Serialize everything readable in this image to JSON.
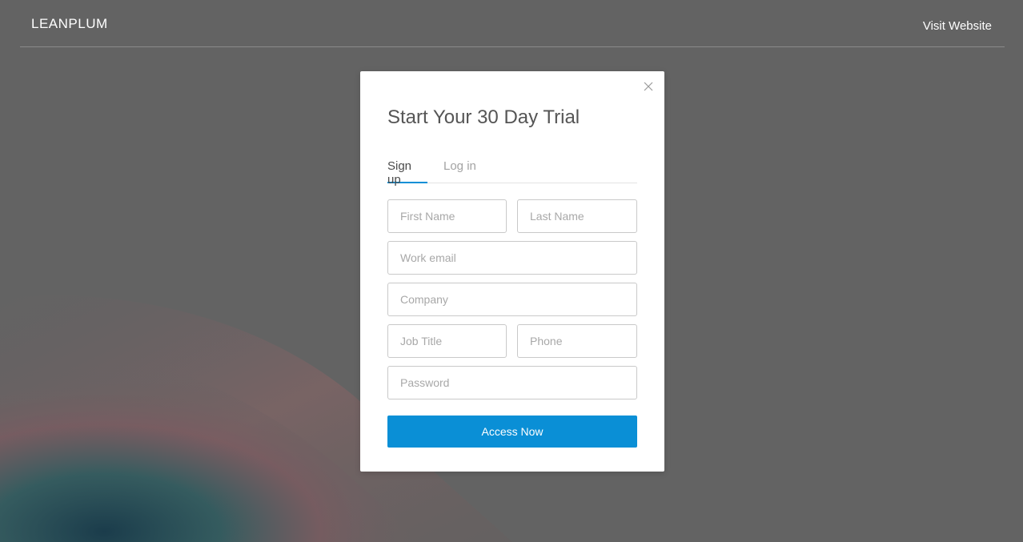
{
  "header": {
    "logo_text": "LEANPLUM",
    "visit_label": "Visit Website"
  },
  "modal": {
    "title": "Start Your 30 Day Trial",
    "close_icon": "close-icon",
    "tabs": [
      {
        "label": "Sign up",
        "active": true
      },
      {
        "label": "Log in",
        "active": false
      }
    ],
    "fields": {
      "first_name": {
        "placeholder": "First Name",
        "value": ""
      },
      "last_name": {
        "placeholder": "Last Name",
        "value": ""
      },
      "work_email": {
        "placeholder": "Work email",
        "value": ""
      },
      "company": {
        "placeholder": "Company",
        "value": ""
      },
      "job_title": {
        "placeholder": "Job Title",
        "value": ""
      },
      "phone": {
        "placeholder": "Phone",
        "value": ""
      },
      "password": {
        "placeholder": "Password",
        "value": ""
      }
    },
    "submit_label": "Access Now"
  },
  "colors": {
    "background": "#636363",
    "accent": "#0a8fd6",
    "modal_bg": "#ffffff"
  }
}
